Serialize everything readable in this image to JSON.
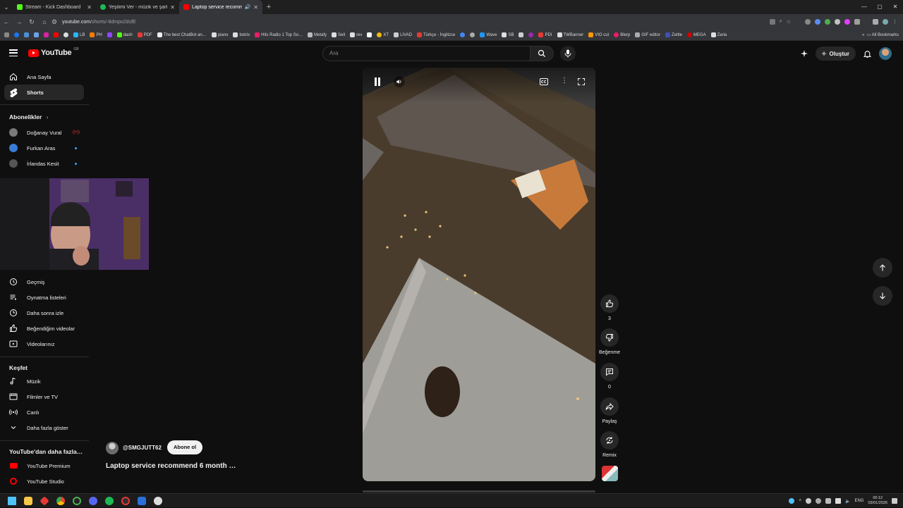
{
  "browser": {
    "tabs": [
      {
        "title": "Stream - Kick Dashboard",
        "icon": "kick-icon",
        "color": "#53fc18",
        "active": false
      },
      {
        "title": "Yeşilimi Ver - müzik ve şarkı sözl…",
        "icon": "spotify-icon",
        "color": "#1db954",
        "active": false
      },
      {
        "title": "Laptop service recommend",
        "icon": "youtube-icon",
        "color": "#ff0000",
        "active": true
      }
    ],
    "url_host": "youtube.com",
    "url_path": "/shorts/-8dmpo2dsfE",
    "bookmarks": [
      "LB",
      "PH",
      "dash",
      "PDF",
      "The best ChatBot an…",
      "piano",
      "botrix",
      "Hits Radio 1 Top So…",
      "Metafy",
      "Sell",
      "rev",
      "XT",
      "LIVAD",
      "Türkçe - İngilizce",
      "Wave",
      "SB",
      "PDI",
      "TWBanner",
      "VIO cut",
      "Blerp",
      "GIF editor",
      "Zettle",
      "MEGA",
      "Zaria"
    ],
    "all_bookmarks": "All Bookmarks"
  },
  "header": {
    "logo_text": "YouTube",
    "logo_country": "GB",
    "search_placeholder": "Ara",
    "create_label": "Oluştur"
  },
  "sidebar": {
    "main": [
      {
        "label": "Ana Sayfa",
        "icon": "home-icon"
      },
      {
        "label": "Shorts",
        "icon": "shorts-icon",
        "active": true
      }
    ],
    "subs_title": "Abonelikler",
    "subscriptions": [
      {
        "name": "Doğanay Vural",
        "live": true,
        "color": "#7a7a7a"
      },
      {
        "name": "Furkan Aras",
        "live": false,
        "color": "#3a7bd5"
      },
      {
        "name": "İrlandas Kesit",
        "live": false,
        "color": "#555555"
      }
    ],
    "library": [
      {
        "label": "Geçmiş",
        "icon": "history-icon"
      },
      {
        "label": "Oynatma listeleri",
        "icon": "playlist-icon"
      },
      {
        "label": "Daha sonra izle",
        "icon": "watch-later-icon"
      },
      {
        "label": "Beğendiğim videolar",
        "icon": "like-icon"
      },
      {
        "label": "Videolarınız",
        "icon": "your-videos-icon"
      }
    ],
    "explore_title": "Keşfet",
    "explore": [
      {
        "label": "Müzik",
        "icon": "music-icon"
      },
      {
        "label": "Filmler ve TV",
        "icon": "movies-icon"
      },
      {
        "label": "Canlı",
        "icon": "live-icon"
      },
      {
        "label": "Daha fazla göster",
        "icon": "chevron-down-icon"
      }
    ],
    "more_title": "YouTube'dan daha fazla…",
    "more": [
      {
        "label": "YouTube Premium",
        "icon": "premium-icon"
      },
      {
        "label": "YouTube Studio",
        "icon": "studio-icon"
      }
    ]
  },
  "short": {
    "channel": "@SMGJUTT62",
    "subscribe_label": "Abone ol",
    "title": "Laptop service recommend 6 month …",
    "likes": "3",
    "dislike_label": "Beğenme",
    "comments": "0",
    "share_label": "Paylaş",
    "remix_label": "Remix",
    "progress": 0.0
  },
  "taskbar": {
    "lang": "ENG",
    "time": "00:12",
    "date": "03/01/2026"
  }
}
